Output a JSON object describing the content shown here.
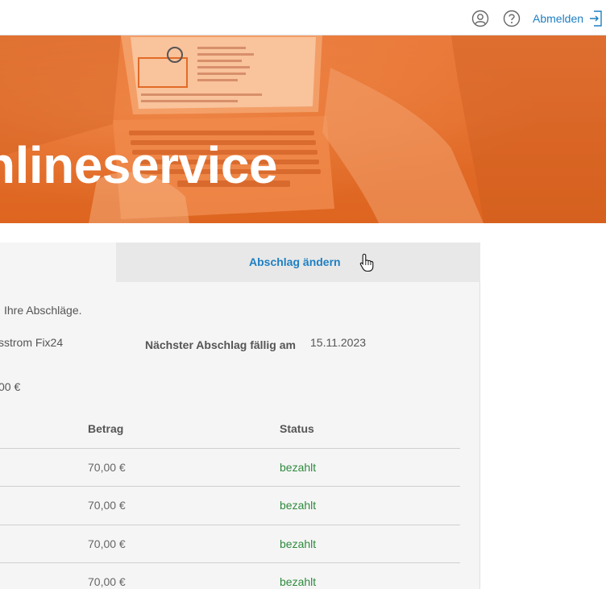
{
  "header": {
    "logout_label": "Abmelden",
    "icons": [
      "user-icon",
      "help-icon",
      "logout-icon"
    ]
  },
  "hero": {
    "title": "nlineservice",
    "accent_color": "#e26b28"
  },
  "tabs": {
    "active_label": "Abschlag ändern"
  },
  "details": {
    "intro_text": "Ihre Abschläge.",
    "tariff_text": "sstrom Fix24",
    "next_due_label": "Nächster Abschlag fällig am",
    "next_due_date": "15.11.2023",
    "amount_text": "00 €"
  },
  "table": {
    "columns": [
      "Betrag",
      "Status"
    ],
    "rows": [
      {
        "amount": "70,00 €",
        "status": "bezahlt"
      },
      {
        "amount": "70,00 €",
        "status": "bezahlt"
      },
      {
        "amount": "70,00 €",
        "status": "bezahlt"
      },
      {
        "amount": "70,00 €",
        "status": "bezahlt"
      }
    ],
    "status_color": "#2e8b3e"
  },
  "colors": {
    "link": "#1e7fc2",
    "panel_bg": "#f5f5f5"
  }
}
